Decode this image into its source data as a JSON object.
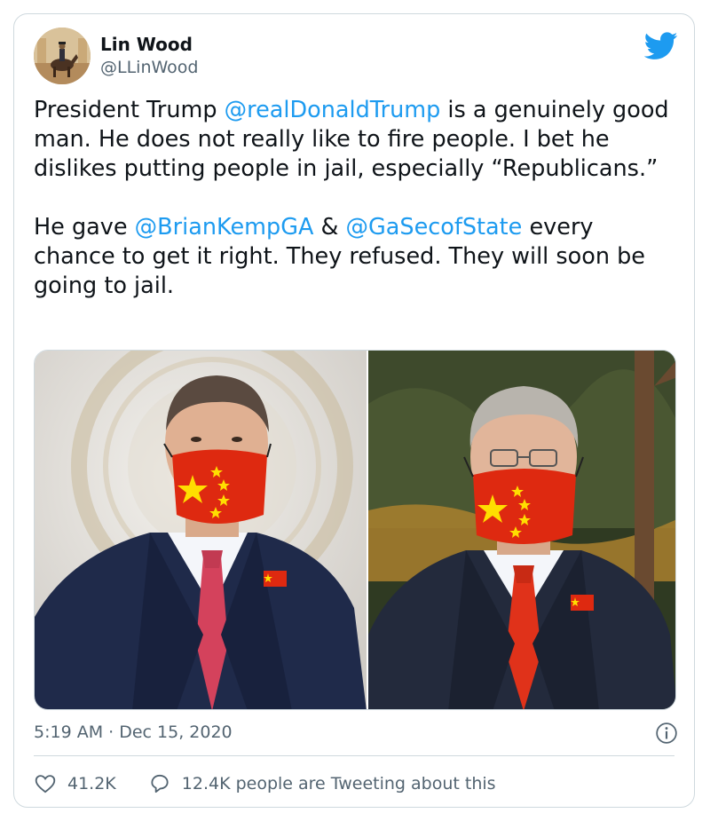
{
  "tweet": {
    "author_name": "Lin Wood",
    "author_handle": "@LLinWood",
    "paragraph1": [
      {
        "text": "President Trump ",
        "mention": false
      },
      {
        "text": "@realDonaldTrump",
        "mention": true
      },
      {
        "text": " is a genuinely good man. He does not really like to fire people. I bet he dislikes putting people in jail, especially “Republicans.”",
        "mention": false
      }
    ],
    "paragraph2": [
      {
        "text": "He gave ",
        "mention": false
      },
      {
        "text": "@BrianKempGA",
        "mention": true
      },
      {
        "text": " & ",
        "mention": false
      },
      {
        "text": "@GaSecofState",
        "mention": true
      },
      {
        "text": " every chance to get it right. They refused. They will soon be going to jail.",
        "mention": false
      }
    ],
    "timestamp": "5:19 AM · Dec 15, 2020",
    "likes": "41.2K",
    "retweet_text": "12.4K people are Tweeting about this"
  },
  "colors": {
    "link": "#1d9bf0",
    "secondary_text": "#536471",
    "border": "#cfd9de",
    "twitter_blue": "#1d9bf0",
    "mask_red": "#de2910",
    "star_yellow": "#ffde00"
  },
  "icons": {
    "logo": "twitter-bird-icon",
    "info": "info-icon",
    "like": "heart-icon",
    "conversation": "speech-bubble-icon"
  }
}
